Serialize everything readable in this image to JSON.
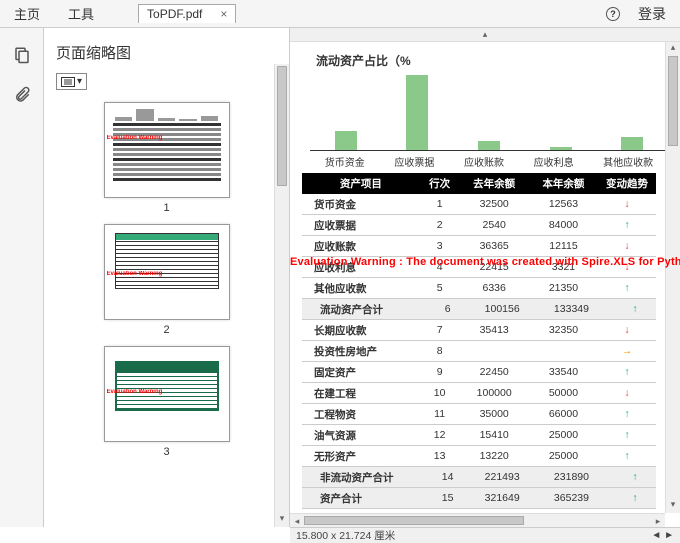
{
  "toolbar": {
    "home": "主页",
    "tools": "工具",
    "login": "登录",
    "help": "?"
  },
  "file_tab": {
    "name": "ToPDF.pdf",
    "close": "×"
  },
  "sidebar": {
    "title": "页面缩略图",
    "thumbs": [
      "1",
      "2",
      "3"
    ]
  },
  "chart": {
    "title": "流动资产占比（%",
    "labels": [
      "货币资金",
      "应收票据",
      "应收账款",
      "应收利息",
      "其他应收款"
    ],
    "heights": [
      20,
      76,
      10,
      4,
      14
    ]
  },
  "columns": [
    "资产项目",
    "行次",
    "去年余额",
    "本年余额",
    "变动趋势"
  ],
  "eval_warning": "Evaluation Warning : The document was created with Spire.XLS for Python",
  "rows": [
    {
      "n": "货币资金",
      "i": "1",
      "a": "32500",
      "b": "12563",
      "t": "dn",
      "sub": false
    },
    {
      "n": "应收票据",
      "i": "2",
      "a": "2540",
      "b": "84000",
      "t": "up",
      "sub": false
    },
    {
      "n": "应收账款",
      "i": "3",
      "a": "36365",
      "b": "12115",
      "t": "dn",
      "sub": false
    },
    {
      "n": "应收利息",
      "i": "4",
      "a": "22415",
      "b": "3321",
      "t": "dn",
      "sub": false
    },
    {
      "n": "其他应收款",
      "i": "5",
      "a": "6336",
      "b": "21350",
      "t": "up",
      "sub": false
    },
    {
      "n": "流动资产合计",
      "i": "6",
      "a": "100156",
      "b": "133349",
      "t": "up",
      "sub": true
    },
    {
      "n": "长期应收款",
      "i": "7",
      "a": "35413",
      "b": "32350",
      "t": "dn",
      "sub": false
    },
    {
      "n": "投资性房地产",
      "i": "8",
      "a": "",
      "b": "",
      "t": "rt",
      "sub": false
    },
    {
      "n": "固定资产",
      "i": "9",
      "a": "22450",
      "b": "33540",
      "t": "up",
      "sub": false
    },
    {
      "n": "在建工程",
      "i": "10",
      "a": "100000",
      "b": "50000",
      "t": "dn",
      "sub": false
    },
    {
      "n": "工程物资",
      "i": "11",
      "a": "35000",
      "b": "66000",
      "t": "up",
      "sub": false
    },
    {
      "n": "油气资源",
      "i": "12",
      "a": "15410",
      "b": "25000",
      "t": "up",
      "sub": false
    },
    {
      "n": "无形资产",
      "i": "13",
      "a": "13220",
      "b": "25000",
      "t": "up",
      "sub": false
    },
    {
      "n": "非流动资产合计",
      "i": "14",
      "a": "221493",
      "b": "231890",
      "t": "up",
      "sub": true
    },
    {
      "n": "资产合计",
      "i": "15",
      "a": "321649",
      "b": "365239",
      "t": "up",
      "sub": true
    }
  ],
  "status": {
    "dims": "15.800 x 21.724 厘米",
    "arrows": "◄ ►"
  }
}
